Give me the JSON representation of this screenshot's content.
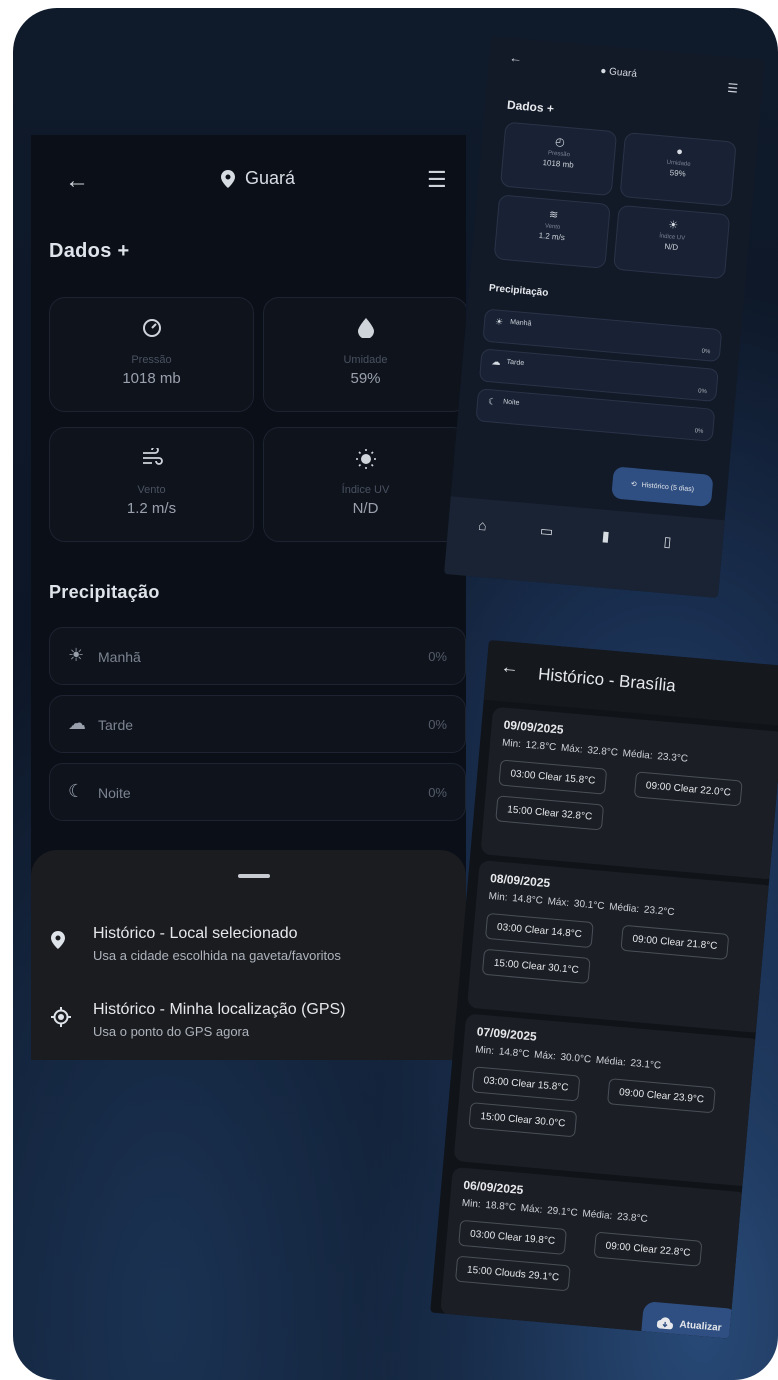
{
  "screen_a": {
    "header": {
      "back_icon": "arrow-left",
      "location_icon": "map-pin",
      "location": "Guará",
      "menu_icon": "hamburger"
    },
    "section_title": "Dados +",
    "cards": [
      {
        "icon": "gauge-icon",
        "glyph": "◴",
        "label": "Pressão",
        "value": "1018 mb"
      },
      {
        "icon": "droplet-icon",
        "glyph": "💧",
        "label": "Umidade",
        "value": "59%"
      },
      {
        "icon": "wind-icon",
        "glyph": "≋",
        "label": "Vento",
        "value": "1.2 m/s"
      },
      {
        "icon": "sun-icon",
        "glyph": "☀",
        "label": "Índice UV",
        "value": "N/D"
      }
    ],
    "precip_title": "Precipitação",
    "precip": [
      {
        "icon": "sun-icon",
        "glyph": "☀",
        "label": "Manhã",
        "value": "0%"
      },
      {
        "icon": "cloud-icon",
        "glyph": "☁",
        "label": "Tarde",
        "value": "0%"
      },
      {
        "icon": "moon-icon",
        "glyph": "☾",
        "label": "Noite",
        "value": "0%"
      }
    ],
    "sheet": {
      "options": [
        {
          "icon": "map-pin-icon",
          "title": "Histórico - Local selecionado",
          "subtitle": "Usa a cidade escolhida na gaveta/favoritos"
        },
        {
          "icon": "gps-icon",
          "title": "Histórico - Minha localização (GPS)",
          "subtitle": "Usa o ponto do GPS agora"
        }
      ]
    }
  },
  "screen_b": {
    "location": "Guará",
    "section_title": "Dados +",
    "cards": [
      {
        "label": "Pressão",
        "value": "1018 mb"
      },
      {
        "label": "Umidade",
        "value": "59%"
      },
      {
        "label": "Vento",
        "value": "1.2 m/s"
      },
      {
        "label": "Índice UV",
        "value": "N/D"
      }
    ],
    "precip_title": "Precipitação",
    "precip": [
      {
        "label": "Manhã",
        "value": "0%"
      },
      {
        "label": "Tarde",
        "value": "0%"
      },
      {
        "label": "Noite",
        "value": "0%"
      }
    ],
    "history_button": "Histórico (5 dias)",
    "nav_icons": [
      "home-icon",
      "calendar-icon",
      "bar-chart-icon",
      "map-icon"
    ]
  },
  "screen_c": {
    "title": "Histórico - Brasília",
    "days": [
      {
        "date": "09/09/2025",
        "summary": "Min: 12.8°C  Máx: 32.8°C  Média: 23.3°C",
        "chips": [
          "03:00 Clear 15.8°C",
          "09:00 Clear 22.0°C",
          "15:00 Clear 32.8°C"
        ]
      },
      {
        "date": "08/09/2025",
        "summary": "Min: 14.8°C  Máx: 30.1°C  Média: 23.2°C",
        "chips": [
          "03:00 Clear 14.8°C",
          "09:00 Clear 21.8°C",
          "15:00 Clear 30.1°C"
        ]
      },
      {
        "date": "07/09/2025",
        "summary": "Min: 14.8°C  Máx: 30.0°C  Média: 23.1°C",
        "chips": [
          "03:00 Clear 15.8°C",
          "09:00 Clear 23.9°C",
          "15:00 Clear 30.0°C"
        ]
      },
      {
        "date": "06/09/2025",
        "summary": "Min: 18.8°C  Máx: 29.1°C  Média: 23.8°C",
        "chips": [
          "03:00 Clear 19.8°C",
          "09:00 Clear 22.8°C",
          "15:00 Clouds 29.1°C"
        ]
      }
    ],
    "fab": "Atualizar"
  },
  "colors": {
    "accent": "#2f4f82",
    "background": "#0b0f17",
    "sheet": "#1a1c20"
  }
}
